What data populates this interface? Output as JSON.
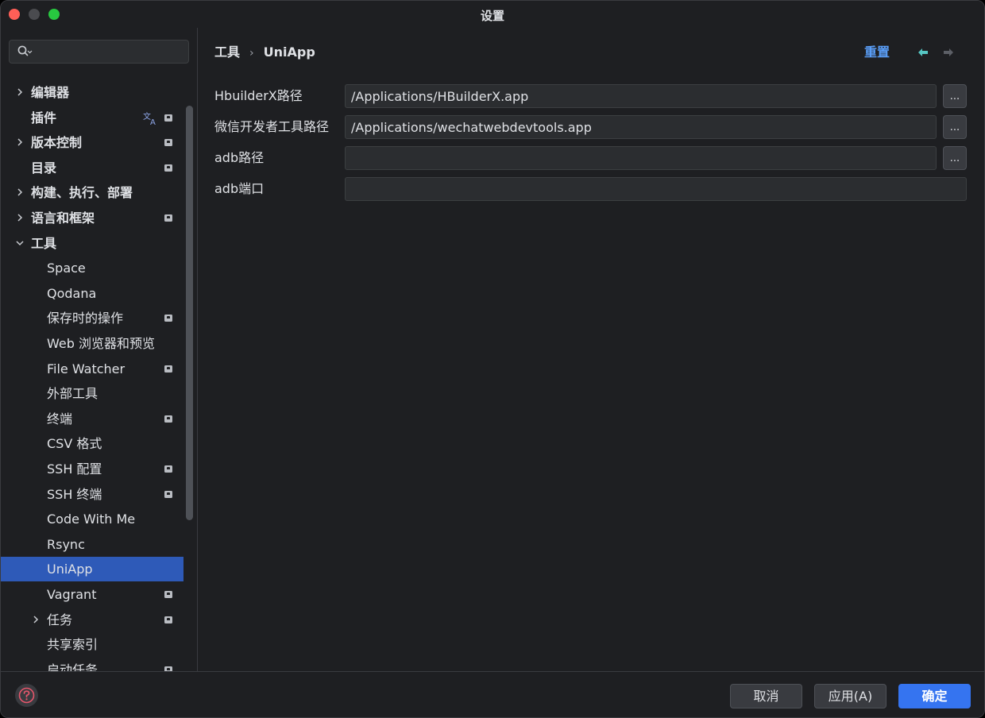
{
  "window": {
    "title": "设置"
  },
  "search": {
    "placeholder": ""
  },
  "sidebar": {
    "items": [
      {
        "label": "编辑器",
        "level": 0,
        "chevron": "right",
        "badge": false,
        "bold": true
      },
      {
        "label": "插件",
        "level": 0,
        "chevron": "none",
        "badge": true,
        "translate": true,
        "bold": true
      },
      {
        "label": "版本控制",
        "level": 0,
        "chevron": "right",
        "badge": true,
        "bold": true
      },
      {
        "label": "目录",
        "level": 0,
        "chevron": "none",
        "badge": true,
        "bold": true
      },
      {
        "label": "构建、执行、部署",
        "level": 0,
        "chevron": "right",
        "badge": false,
        "bold": true
      },
      {
        "label": "语言和框架",
        "level": 0,
        "chevron": "right",
        "badge": true,
        "bold": true
      },
      {
        "label": "工具",
        "level": 0,
        "chevron": "down",
        "badge": false,
        "bold": true
      },
      {
        "label": "Space",
        "level": 1,
        "chevron": "none",
        "badge": false
      },
      {
        "label": "Qodana",
        "level": 1,
        "chevron": "none",
        "badge": false
      },
      {
        "label": "保存时的操作",
        "level": 1,
        "chevron": "none",
        "badge": true
      },
      {
        "label": "Web 浏览器和预览",
        "level": 1,
        "chevron": "none",
        "badge": false
      },
      {
        "label": "File Watcher",
        "level": 1,
        "chevron": "none",
        "badge": true
      },
      {
        "label": "外部工具",
        "level": 1,
        "chevron": "none",
        "badge": false
      },
      {
        "label": "终端",
        "level": 1,
        "chevron": "none",
        "badge": true
      },
      {
        "label": "CSV 格式",
        "level": 1,
        "chevron": "none",
        "badge": false
      },
      {
        "label": "SSH 配置",
        "level": 1,
        "chevron": "none",
        "badge": true
      },
      {
        "label": "SSH 终端",
        "level": 1,
        "chevron": "none",
        "badge": true
      },
      {
        "label": "Code With Me",
        "level": 1,
        "chevron": "none",
        "badge": false
      },
      {
        "label": "Rsync",
        "level": 1,
        "chevron": "none",
        "badge": false
      },
      {
        "label": "UniApp",
        "level": 1,
        "chevron": "none",
        "badge": false,
        "selected": true
      },
      {
        "label": "Vagrant",
        "level": 1,
        "chevron": "none",
        "badge": true
      },
      {
        "label": "任务",
        "level": 1,
        "chevron": "right",
        "badge": true
      },
      {
        "label": "共享索引",
        "level": 1,
        "chevron": "none",
        "badge": false
      },
      {
        "label": "启动任务",
        "level": 1,
        "chevron": "none",
        "badge": true
      }
    ]
  },
  "breadcrumb": {
    "parent": "工具",
    "separator": "›",
    "current": "UniApp"
  },
  "header": {
    "reset_label": "重置"
  },
  "form": {
    "rows": [
      {
        "label": "HbuilderX路径",
        "value": "/Applications/HBuilderX.app",
        "browse": "..."
      },
      {
        "label": "微信开发者工具路径",
        "value": "/Applications/wechatwebdevtools.app",
        "browse": "..."
      },
      {
        "label": "adb路径",
        "value": "",
        "browse": "..."
      },
      {
        "label": "adb端口",
        "value": ""
      }
    ]
  },
  "footer": {
    "cancel_label": "取消",
    "apply_label": "应用(A)",
    "ok_label": "确定"
  },
  "colors": {
    "accent": "#3574f0",
    "selection": "#2e5ab8",
    "link": "#5a9ff9",
    "background": "#1e1f22"
  }
}
